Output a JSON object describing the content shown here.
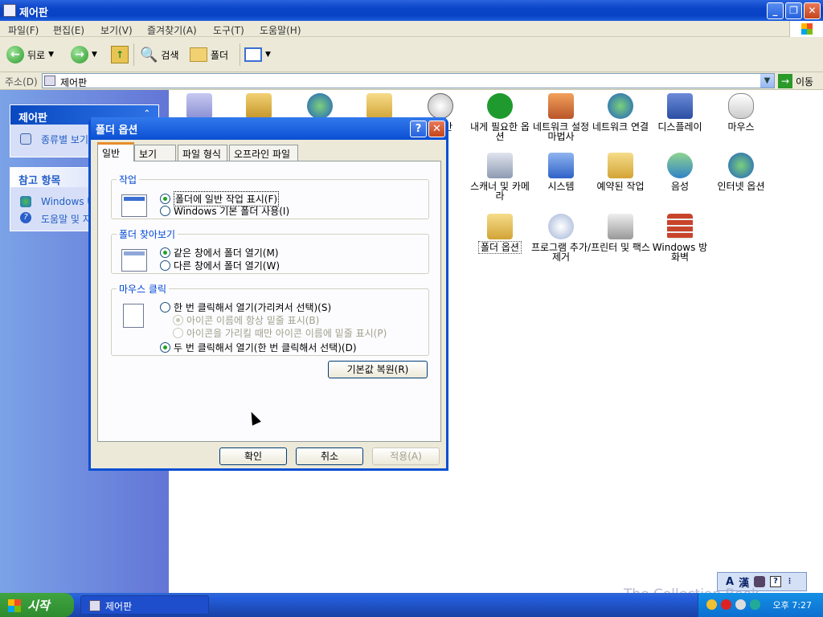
{
  "window": {
    "title": "제어판"
  },
  "menu": [
    "파일(F)",
    "편집(E)",
    "보기(V)",
    "즐겨찾기(A)",
    "도구(T)",
    "도움말(H)"
  ],
  "toolbar": {
    "back": "뒤로",
    "search": "검색",
    "folders": "폴더"
  },
  "address": {
    "label": "주소(D)",
    "value": "제어판",
    "go": "이동"
  },
  "leftpane": {
    "panel_title": "제어판",
    "switch_view": "종류별 보기",
    "see_also_title": "참고 항목",
    "links": [
      "Windows Update",
      "도움말 및 지원"
    ]
  },
  "icons": [
    "시간",
    "내게 필요한 옵션",
    "네트워크 설정 마법사",
    "네트워크 연결",
    "디스플레이",
    "마우스",
    "스캐너 및 카메라",
    "시스템",
    "예약된 작업",
    "음성",
    "인터넷 옵션",
    "폴더 옵션",
    "프로그램 추가/제거",
    "프린터 및 팩스",
    "Windows 방화벽"
  ],
  "dialog": {
    "title": "폴더 옵션",
    "tabs": [
      "일반",
      "보기",
      "파일 형식",
      "오프라인 파일"
    ],
    "tasks": {
      "legend": "작업",
      "opt1": "폴더에 일반 작업 표시(F)",
      "opt2": "Windows 기본 폴더 사용(I)"
    },
    "browse": {
      "legend": "폴더 찾아보기",
      "opt1": "같은 창에서 폴더 열기(M)",
      "opt2": "다른 창에서 폴더 열기(W)"
    },
    "click": {
      "legend": "마우스 클릭",
      "opt1": "한 번 클릭해서 열기(가리켜서 선택)(S)",
      "sub1": "아이콘 이름에 항상 밑줄 표시(B)",
      "sub2": "아이콘을 가리킬 때만 아이콘 이름에 밑줄 표시(P)",
      "opt2": "두 번 클릭해서 열기(한 번 클릭해서 선택)(D)"
    },
    "restore": "기본값 복원(R)",
    "ok": "확인",
    "cancel": "취소",
    "apply": "적용(A)"
  },
  "taskbar": {
    "start": "시작",
    "task": "제어판",
    "clock": "오후 7:27"
  },
  "langbar": {
    "a": "A",
    "han": "漢"
  },
  "watermark": "The Collection Book"
}
